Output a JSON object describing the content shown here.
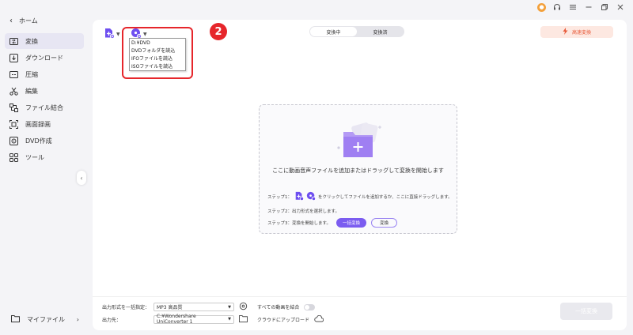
{
  "sidebar": {
    "home_label": "ホーム",
    "items": [
      {
        "label": "変換",
        "icon": "convert-icon",
        "active": true
      },
      {
        "label": "ダウンロード",
        "icon": "download-icon",
        "active": false
      },
      {
        "label": "圧縮",
        "icon": "compress-icon",
        "active": false
      },
      {
        "label": "編集",
        "icon": "edit-icon",
        "active": false
      },
      {
        "label": "ファイル結合",
        "icon": "merge-icon",
        "active": false
      },
      {
        "label": "画面録画",
        "icon": "screen-record-icon",
        "active": false
      },
      {
        "label": "DVD作成",
        "icon": "dvd-icon",
        "active": false
      },
      {
        "label": "ツール",
        "icon": "tools-icon",
        "active": false
      }
    ],
    "my_files_label": "マイファイル"
  },
  "header": {
    "tabs": [
      {
        "label": "変換中",
        "active": true
      },
      {
        "label": "変換済",
        "active": false
      }
    ],
    "high_speed_label": "高速変換"
  },
  "dvd_menu": {
    "items": [
      "D:¥DVD",
      "DVDフォルダを読込",
      "IFOファイルを読込",
      "ISOファイルを読込"
    ],
    "callout_number": "2"
  },
  "dropzone": {
    "main_text": "ここに動画音声ファイルを追加またはドラッグして変換を開始します",
    "step1_label": "ステップ1：",
    "step1_text": "をクリックしてファイルを追加するか、ここに直接ドラッグします。",
    "step2_text": "ステップ2：出力形式を選択します。",
    "step3_label": "ステップ3：変換を開始します。",
    "batch_convert_label": "一括変換",
    "convert_label": "変換"
  },
  "bottom": {
    "output_format_label": "出力形式を一括指定：",
    "output_format_value": "MP3 高品質",
    "merge_label": "すべての動画を結合",
    "output_path_label": "出力先：",
    "output_path_value": "C:¥Wondershare UniConverter 1",
    "cloud_upload_label": "クラウドにアップロード",
    "convert_all_label": "一括変換"
  },
  "colors": {
    "accent": "#7b5cf0",
    "callout": "#e6262b",
    "high_speed": "#e85a3a",
    "avatar": "#f3a03b"
  }
}
